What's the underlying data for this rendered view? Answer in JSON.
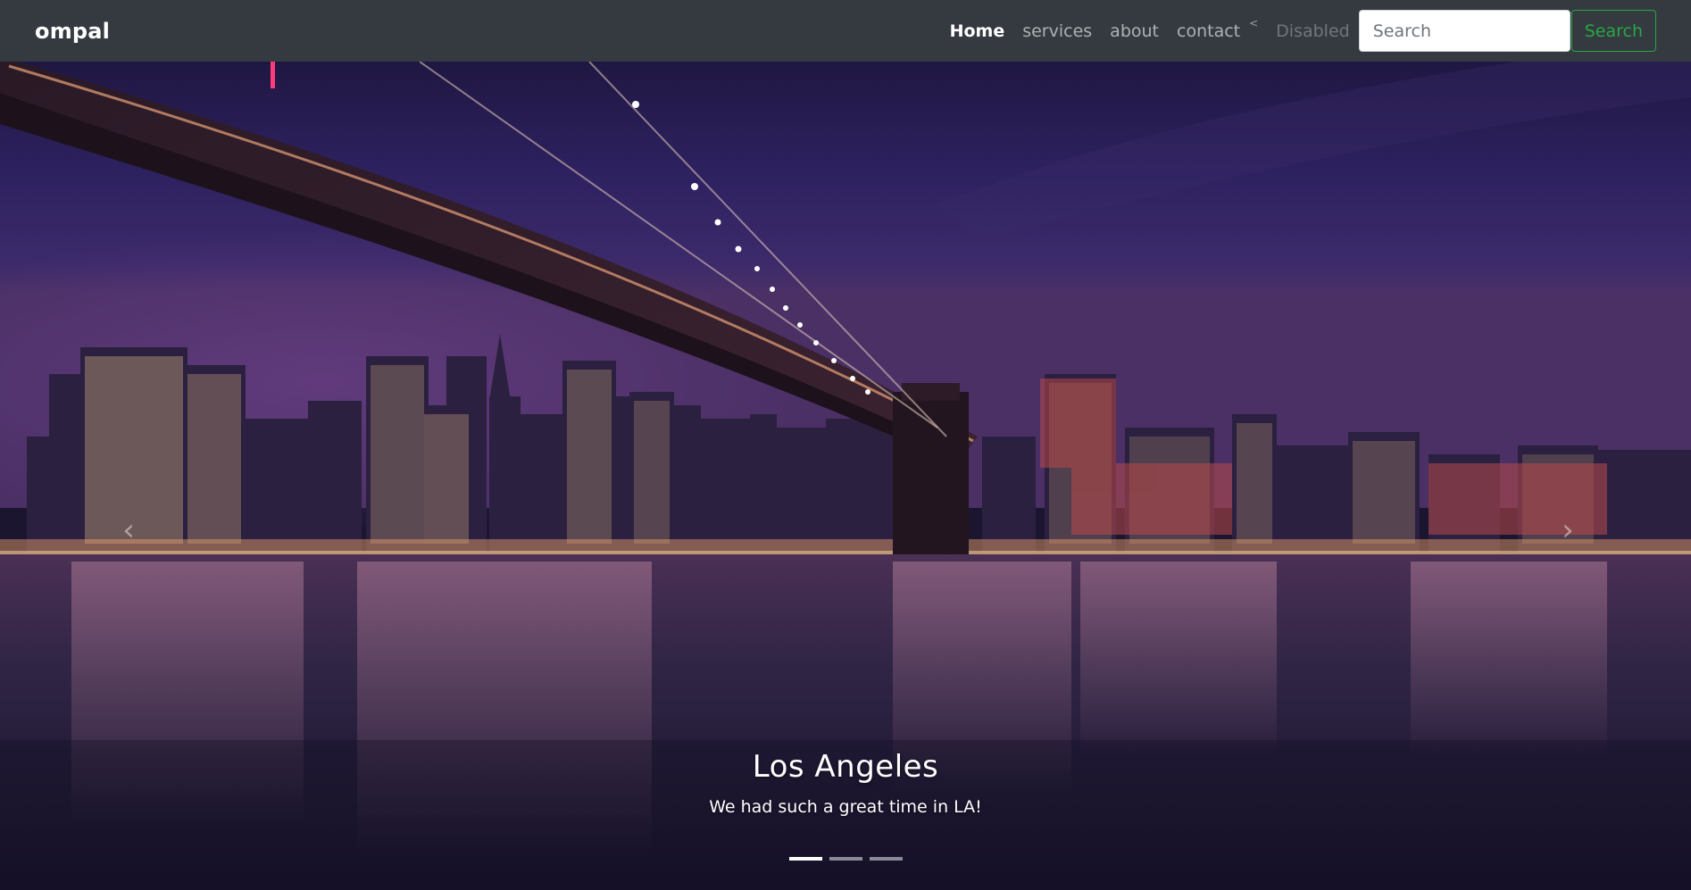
{
  "navbar": {
    "brand": "ompal",
    "links": [
      {
        "label": "Home",
        "active": true
      },
      {
        "label": "services"
      },
      {
        "label": "about"
      },
      {
        "label": "contact"
      },
      {
        "label": "Disabled",
        "disabled": true
      }
    ],
    "search": {
      "placeholder": "Search",
      "button_label": "Search"
    }
  },
  "carousel": {
    "caption_title": "Los Angeles",
    "caption_text": "We had such a great time in LA!",
    "active_index": 0,
    "slide_count": 3
  },
  "colors": {
    "navbar_bg": "#343a40",
    "search_accent": "#28a745"
  }
}
